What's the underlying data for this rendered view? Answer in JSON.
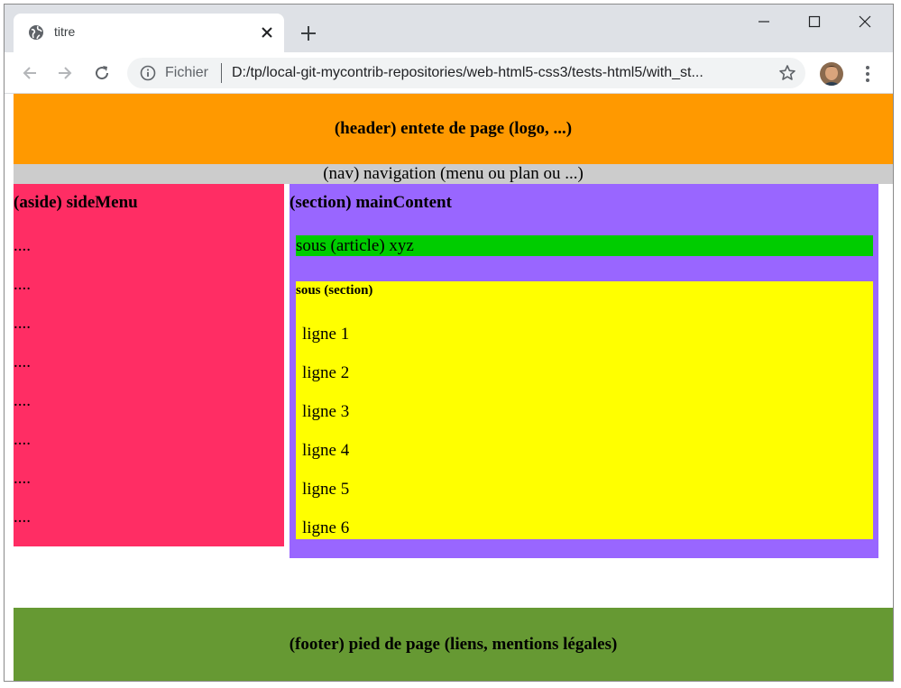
{
  "browser": {
    "tab": {
      "title": "titre"
    },
    "omnibox": {
      "scheme_label": "Fichier",
      "url": "D:/tp/local-git-mycontrib-repositories/web-html5-css3/tests-html5/with_st..."
    }
  },
  "page": {
    "header_text": "(header) entete de page (logo, ...)",
    "nav_text": "(nav) navigation (menu ou plan ou ...)",
    "aside": {
      "title": "(aside) sideMenu",
      "items": [
        "....",
        "....",
        "....",
        "....",
        "....",
        "....",
        "....",
        "...."
      ]
    },
    "main_section": {
      "title": "(section) mainContent",
      "article_text": "sous (article) xyz",
      "sub_section": {
        "title": "sous (section)",
        "lines": [
          "ligne 1",
          "ligne 2",
          "ligne 3",
          "ligne 4",
          "ligne 5",
          "ligne 6"
        ]
      }
    },
    "footer_text": "(footer) pied de page (liens, mentions légales)"
  },
  "colors": {
    "header": "#ff9900",
    "nav": "#cccccc",
    "aside": "#ff2d64",
    "section": "#9966ff",
    "article": "#00cc00",
    "sub_section": "#ffff00",
    "footer": "#669933"
  }
}
